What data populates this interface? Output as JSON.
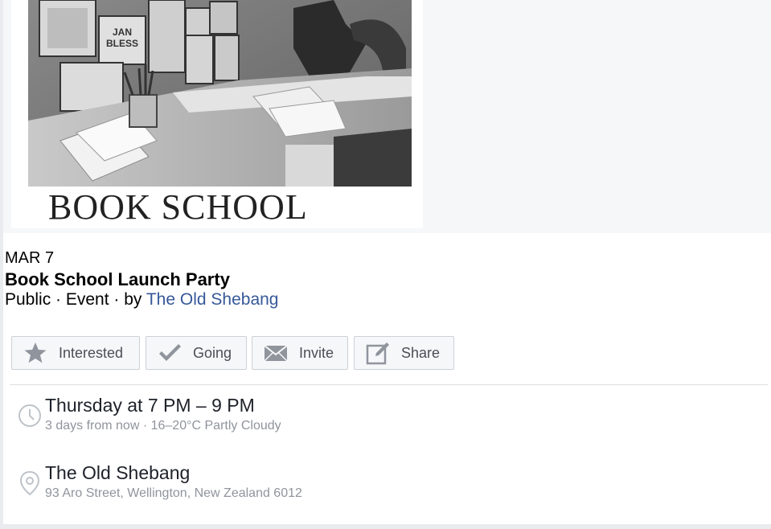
{
  "cover": {
    "caption": "BOOK SCHOOL",
    "poster_text": "JAN\nBLESS"
  },
  "event": {
    "date": "MAR 7",
    "title": "Book School Launch Party",
    "meta_prefix": "Public · Event · by ",
    "host": "The Old Shebang"
  },
  "actions": {
    "interested": "Interested",
    "going": "Going",
    "invite": "Invite",
    "share": "Share"
  },
  "details": {
    "time_main": "Thursday at 7 PM – 9 PM",
    "time_sub": "3 days from now · 16–20°C Partly Cloudy",
    "place_main": "The Old Shebang",
    "place_sub": "93 Aro Street, Wellington, New Zealand 6012"
  },
  "icons": {
    "interested": "star-icon",
    "going": "checkmark-icon",
    "invite": "envelope-icon",
    "share": "edit-icon",
    "time": "clock-icon",
    "place": "location-pin-icon"
  },
  "colors": {
    "link": "#365899",
    "secondary_text": "#90949c",
    "button_text": "#4b4f56",
    "icon_gray": "#90949c"
  }
}
